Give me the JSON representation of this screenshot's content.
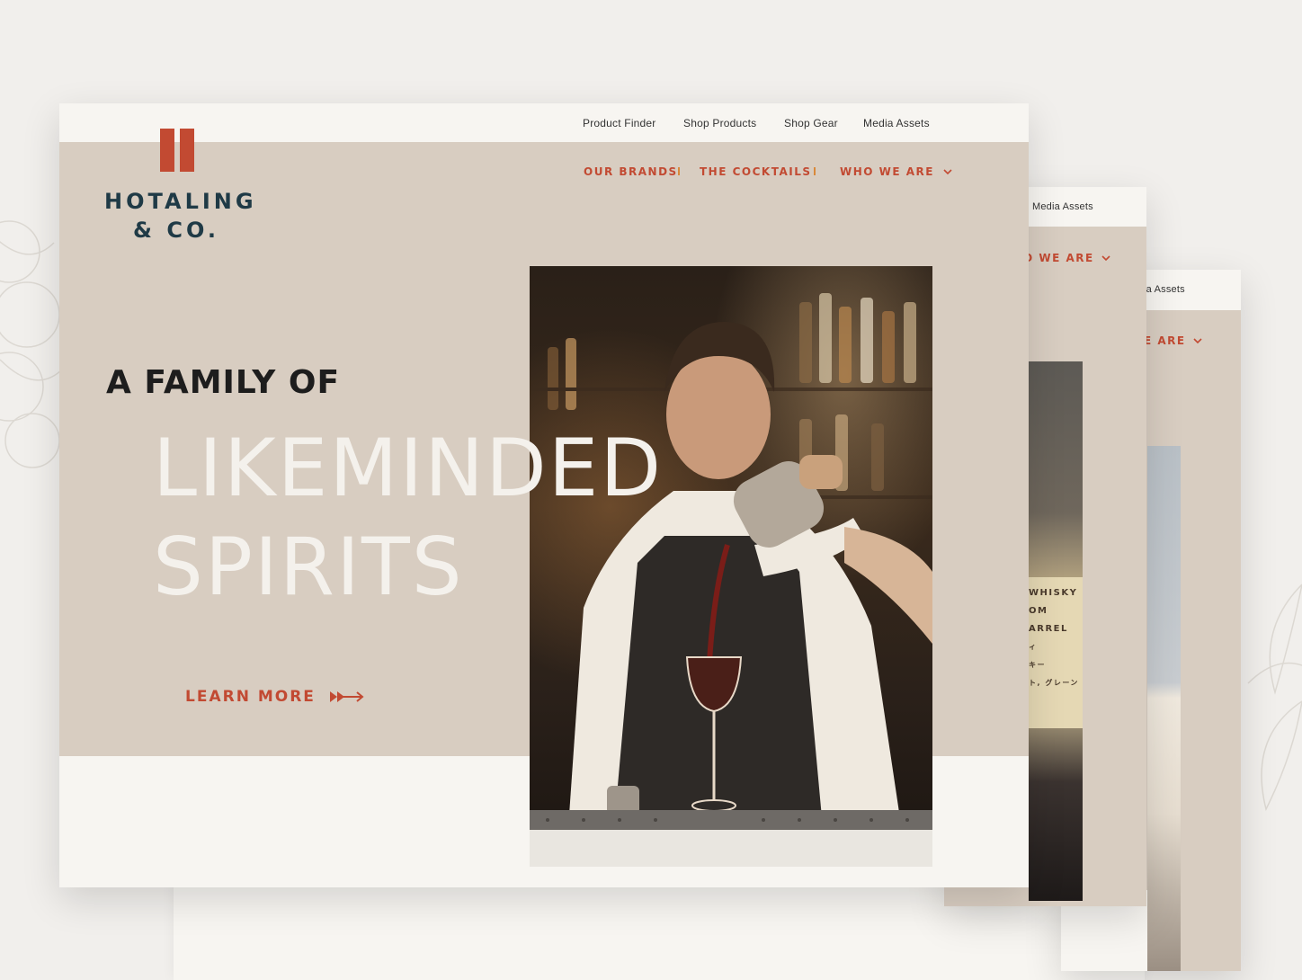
{
  "brand": {
    "name_line1": "HOTALING",
    "name_line2": "& CO.",
    "accent_color": "#c24a32",
    "navy_color": "#1f3a46"
  },
  "utility_nav": [
    {
      "label": "Product Finder"
    },
    {
      "label": "Shop Products"
    },
    {
      "label": "Shop Gear"
    },
    {
      "label": "Media Assets"
    }
  ],
  "main_nav": [
    {
      "label": "OUR BRANDS"
    },
    {
      "label": "THE COCKTAILS"
    },
    {
      "label": "WHO WE ARE",
      "icon": "chevron-down-icon"
    }
  ],
  "hero": {
    "kicker": "A FAMILY OF",
    "line1": "LIKEMINDED",
    "line2": "SPIRITS",
    "cta_label": "LEARN MORE",
    "cta_icon": "arrow-right-icon"
  },
  "card2": {
    "utility_label": "Media Assets",
    "nav_label": "O WE ARE",
    "photo_text": [
      "WHISKY",
      "OM",
      "ARREL",
      "ィ",
      "キー",
      "ト, グレーン"
    ]
  },
  "card3": {
    "utility_label": "ia Assets",
    "nav_label": "E ARE"
  }
}
